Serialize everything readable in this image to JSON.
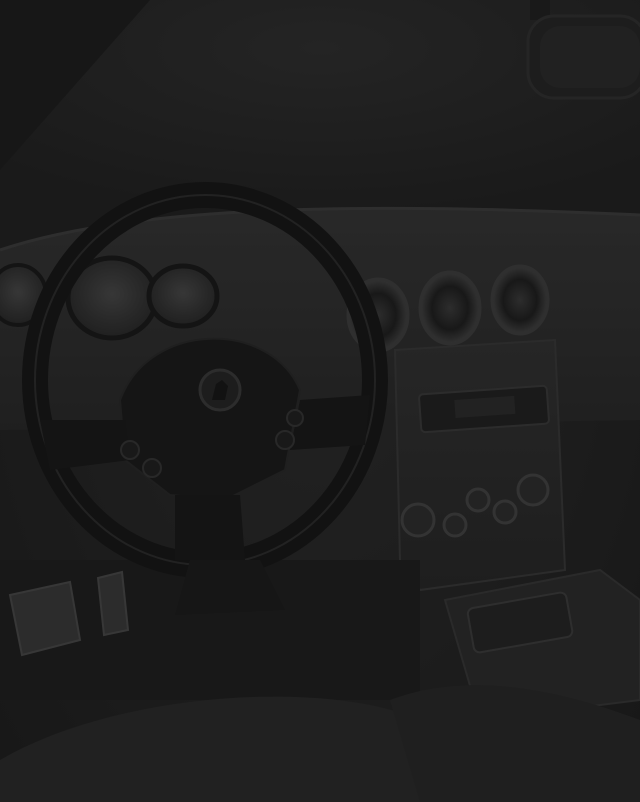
{
  "scene": {
    "subject": "car-interior-photo",
    "palette": {
      "background": "#1f1f1f",
      "dashboard": "#2e2e2e",
      "wheel": "#161616",
      "highlight": "#3a3a3a"
    },
    "icons": [
      "steering-wheel-icon",
      "brand-emblem-icon",
      "air-vent-icon",
      "pedal-icon",
      "rearview-mirror-icon"
    ],
    "brightness_overlay": 0.35
  }
}
